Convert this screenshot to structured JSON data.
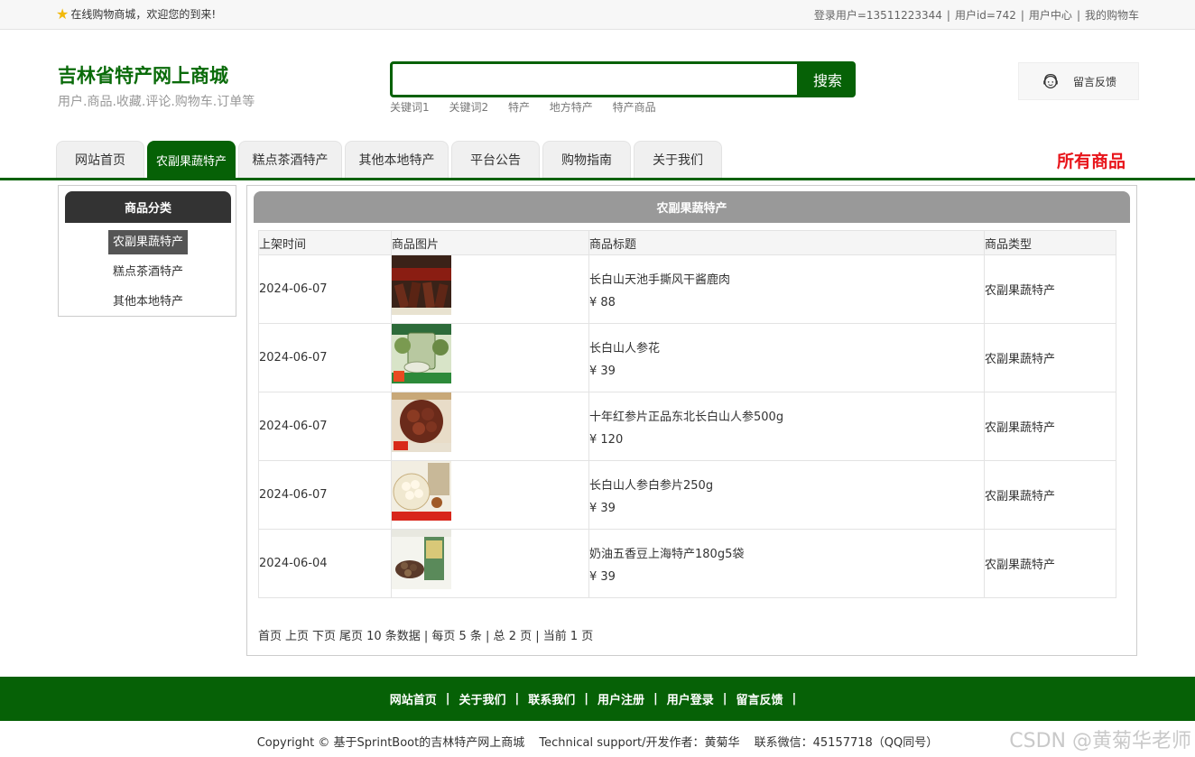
{
  "topbar": {
    "welcome": "在线购物商城，欢迎您的到来!",
    "login_user": "登录用户=13511223344",
    "user_id": "用户id=742",
    "user_center": "用户中心",
    "cart": "我的购物车",
    "sep": "|"
  },
  "brand": {
    "title": "吉林省特产网上商城",
    "subtitle": "用户.商品.收藏.评论.购物车.订单等"
  },
  "search": {
    "value": "",
    "button": "搜索",
    "keywords": [
      "关键词1",
      "关键词2",
      "特产",
      "地方特产",
      "特产商品"
    ]
  },
  "feedback": {
    "label": "留言反馈"
  },
  "nav": {
    "tabs": [
      {
        "label": "网站首页"
      },
      {
        "label": "农副果蔬特产"
      },
      {
        "label": "糕点茶酒特产"
      },
      {
        "label": "其他本地特产"
      },
      {
        "label": "平台公告"
      },
      {
        "label": "购物指南"
      },
      {
        "label": "关于我们"
      }
    ],
    "all_goods": "所有商品"
  },
  "sidebar": {
    "title": "商品分类",
    "items": [
      {
        "label": "农副果蔬特产"
      },
      {
        "label": "糕点茶酒特产"
      },
      {
        "label": "其他本地特产"
      }
    ]
  },
  "main": {
    "title": "农副果蔬特产",
    "columns": [
      "上架时间",
      "商品图片",
      "商品标题",
      "商品类型"
    ],
    "rows": [
      {
        "date": "2024-06-07",
        "title": "长白山天池手撕风干酱鹿肉",
        "price": "¥ 88",
        "type": "农副果蔬特产"
      },
      {
        "date": "2024-06-07",
        "title": "长白山人参花",
        "price": "¥ 39",
        "type": "农副果蔬特产"
      },
      {
        "date": "2024-06-07",
        "title": "十年红参片正品东北长白山人参500g",
        "price": "¥ 120",
        "type": "农副果蔬特产"
      },
      {
        "date": "2024-06-07",
        "title": "长白山人参白参片250g",
        "price": "¥ 39",
        "type": "农副果蔬特产"
      },
      {
        "date": "2024-06-04",
        "title": "奶油五香豆上海特产180g5袋",
        "price": "¥ 39",
        "type": "农副果蔬特产"
      }
    ],
    "pager": {
      "first": "首页",
      "prev": "上页",
      "next": "下页",
      "last": "尾页",
      "summary": "10 条数据 | 每页 5 条 | 总 2 页 | 当前 1 页"
    }
  },
  "footer": {
    "links": [
      "网站首页",
      "关于我们",
      "联系我们",
      "用户注册",
      "用户登录",
      "留言反馈"
    ],
    "bar": "|"
  },
  "copyright": {
    "text": "Copyright © 基于SprintBoot的吉林特产网上商城",
    "support": "Technical support/开发作者：黄菊华",
    "contact": "联系微信：45157718（QQ同号）"
  },
  "watermark": "CSDN @黄菊华老师",
  "colors": {
    "brand_green": "#066106",
    "accent_red": "#e8141a"
  }
}
